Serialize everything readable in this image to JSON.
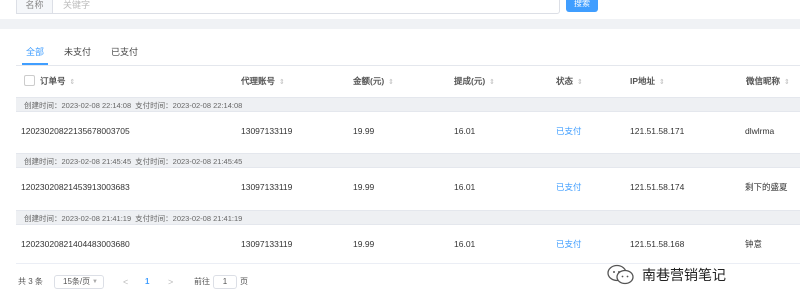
{
  "search": {
    "label": "名称",
    "placeholder": "关键字",
    "button": "搜索"
  },
  "tabs": [
    {
      "label": "全部",
      "active": true
    },
    {
      "label": "未支付",
      "active": false
    },
    {
      "label": "已支付",
      "active": false
    }
  ],
  "columns": {
    "order_no": "订单号",
    "agent": "代理账号",
    "amount": "金额(元)",
    "commission": "提成(元)",
    "status": "状态",
    "ip": "IP地址",
    "wechat": "微信昵称"
  },
  "orders": [
    {
      "created": "创建时间：2023-02-08 22:14:08",
      "paid_at": "支付时间：2023-02-08 22:14:08",
      "order_no": "1202302082213567800370​5",
      "agent": "13097133119",
      "amount": "19.99",
      "commission": "16.01",
      "status": "已支付",
      "ip": "121.51.58.171",
      "wechat": "dlwlrma"
    },
    {
      "created": "创建时间：2023-02-08 21:45:45",
      "paid_at": "支付时间：2023-02-08 21:45:45",
      "order_no": "120230208214539130036​83",
      "agent": "13097133119",
      "amount": "19.99",
      "commission": "16.01",
      "status": "已支付",
      "ip": "121.51.58.174",
      "wechat": "剩下的盛夏"
    },
    {
      "created": "创建时间：2023-02-08 21:41:19",
      "paid_at": "支付时间：2023-02-08 21:41:19",
      "order_no": "120230208214044830036​80",
      "agent": "13097133119",
      "amount": "19.99",
      "commission": "16.01",
      "status": "已支付",
      "ip": "121.51.58.168",
      "wechat": "钟意"
    }
  ],
  "pager": {
    "total": "共 3 条",
    "page_size": "15条/页",
    "prev": "<",
    "current": "1",
    "next": ">",
    "goto_label": "前往",
    "goto_value": "1",
    "page_unit": "页"
  },
  "watermark": {
    "text": "南巷营销笔记",
    "icon": "wechat-icon"
  },
  "colors": {
    "accent": "#409eff",
    "background": "#f0f2f5"
  }
}
